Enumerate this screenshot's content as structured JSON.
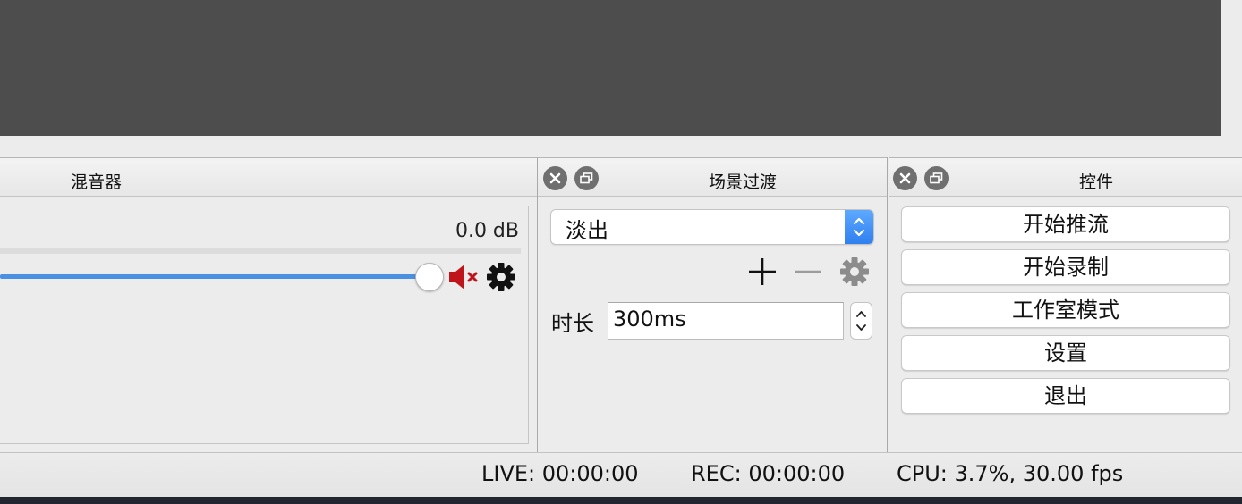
{
  "mixer": {
    "title": "混音器",
    "db_value": "0.0 dB",
    "volume_level": 1.0
  },
  "transitions": {
    "title": "场景过渡",
    "selected": "淡出",
    "duration_label": "时长",
    "duration_value": "300ms"
  },
  "controls": {
    "title": "控件",
    "buttons": [
      "开始推流",
      "开始录制",
      "工作室模式",
      "设置",
      "退出"
    ]
  },
  "status": {
    "live": "LIVE: 00:00:00",
    "rec": "REC: 00:00:00",
    "cpu": "CPU: 3.7%, 30.00 fps"
  },
  "icons": {
    "close": "close-icon",
    "float": "float-icon",
    "mute": "speaker-muted-icon",
    "gear": "gear-icon",
    "add": "plus-icon",
    "remove": "minus-icon"
  },
  "colors": {
    "accent_blue": "#4a90e2",
    "mute_red": "#c0141b",
    "preview_bg": "#4d4d4d"
  }
}
